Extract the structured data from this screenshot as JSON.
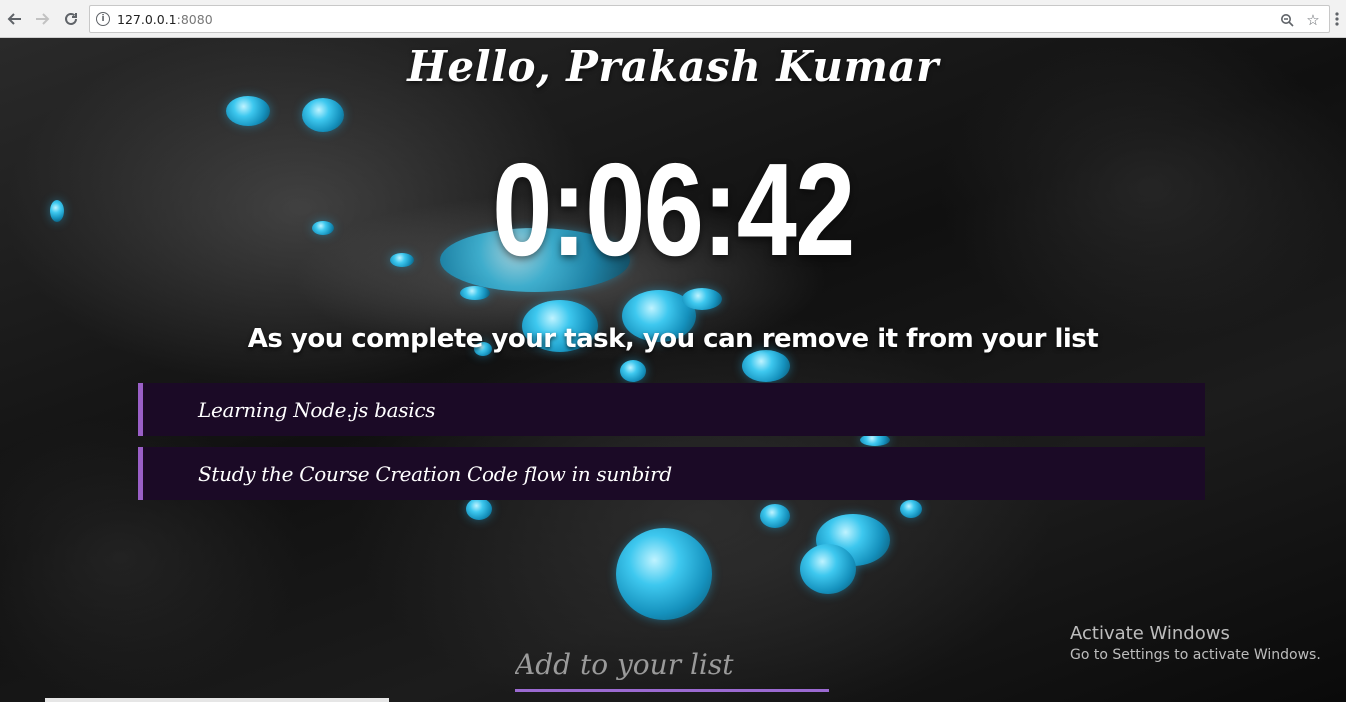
{
  "browser": {
    "url_host": "127.0.0.1",
    "url_port": ":8080",
    "back_icon": "arrow-left-icon",
    "forward_icon": "arrow-right-icon",
    "reload_icon": "reload-icon",
    "info_icon": "info-icon",
    "zoom_icon": "zoom-icon",
    "bookmark_icon": "star-icon",
    "menu_icon": "kebab-menu-icon"
  },
  "page": {
    "greeting": "Hello, Prakash Kumar",
    "clock": "0:06:42",
    "subtitle": "As you complete your task, you can remove it from your list",
    "tasks": [
      {
        "label": "Learning Node.js basics"
      },
      {
        "label": "Study the Course Creation Code flow in sunbird"
      }
    ],
    "add_input": {
      "placeholder": "Add to your list",
      "value": ""
    },
    "accent_color": "#9a5fc7",
    "task_bg_color": "#1b0a26"
  },
  "os_watermark": {
    "title": "Activate Windows",
    "subtitle": "Go to Settings to activate Windows."
  }
}
